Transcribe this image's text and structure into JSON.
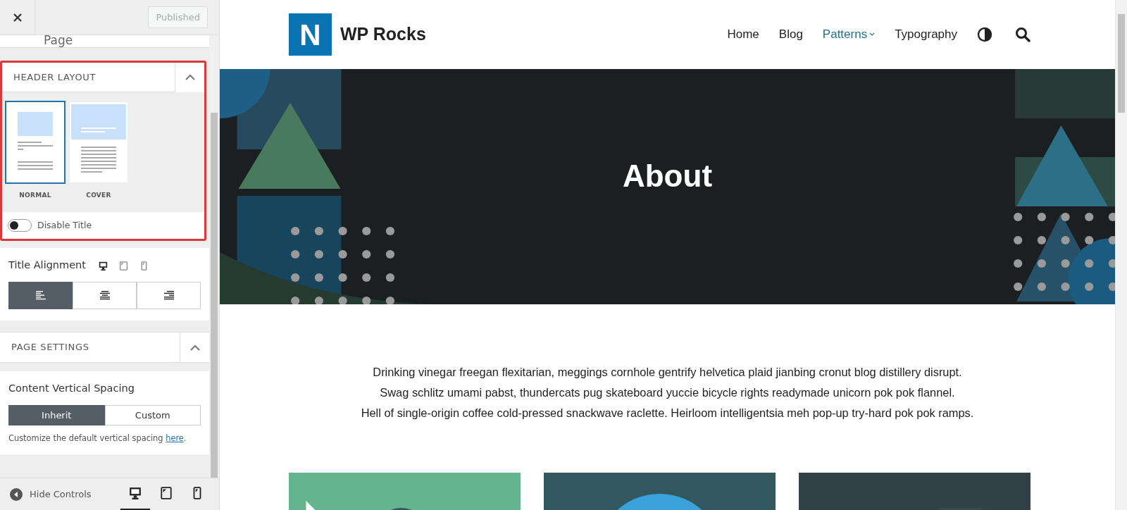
{
  "topbar": {
    "publish_button": "Published"
  },
  "page_label": "Page",
  "header_layout": {
    "title": "HEADER LAYOUT",
    "expanded": true,
    "options": [
      {
        "label": "NORMAL",
        "kind": "normal",
        "selected": true
      },
      {
        "label": "COVER",
        "kind": "cover",
        "selected": false
      }
    ],
    "disable_title": {
      "label": "Disable Title",
      "on": false
    }
  },
  "title_alignment": {
    "label": "Title Alignment",
    "devices": [
      {
        "kind": "desktop",
        "selected": true
      },
      {
        "kind": "tablet",
        "selected": false
      },
      {
        "kind": "mobile",
        "selected": false
      }
    ],
    "options": [
      {
        "kind": "left",
        "selected": true
      },
      {
        "kind": "center",
        "selected": false
      },
      {
        "kind": "right",
        "selected": false
      }
    ]
  },
  "page_settings": {
    "title": "PAGE SETTINGS",
    "expanded": true,
    "spacing_label": "Content Vertical Spacing",
    "spacing_options": [
      {
        "label": "Inherit",
        "selected": true
      },
      {
        "label": "Custom",
        "selected": false
      }
    ],
    "help_text": "Customize the default vertical spacing ",
    "help_link": "here",
    "help_end": "."
  },
  "footer": {
    "hide_label": "Hide Controls",
    "devices": [
      {
        "kind": "desktop",
        "selected": true
      },
      {
        "kind": "tablet",
        "selected": false
      },
      {
        "kind": "mobile",
        "selected": false
      }
    ]
  },
  "site": {
    "logo_letter": "N",
    "title": "WP Rocks",
    "nav": [
      {
        "label": "Home",
        "selected": false,
        "has_submenu": false
      },
      {
        "label": "Blog",
        "selected": false,
        "has_submenu": false
      },
      {
        "label": "Patterns",
        "selected": true,
        "has_submenu": true
      },
      {
        "label": "Typography",
        "selected": false,
        "has_submenu": false
      }
    ],
    "hero_title": "About",
    "paragraph": [
      "Drinking vinegar freegan flexitarian, meggings cornhole gentrify helvetica plaid jianbing cronut blog distillery disrupt.",
      "Swag schlitz umami pabst, thundercats pug skateboard yuccie bicycle rights readymade unicorn pok pok flannel.",
      "Hell of single-origin coffee cold-pressed snackwave raclette. Heirloom intelligentsia meh pop-up try-hard pok pok ramps."
    ],
    "cards": [
      {
        "kind": "picture"
      },
      {
        "kind": "picture"
      },
      {
        "kind": "picture"
      }
    ]
  }
}
